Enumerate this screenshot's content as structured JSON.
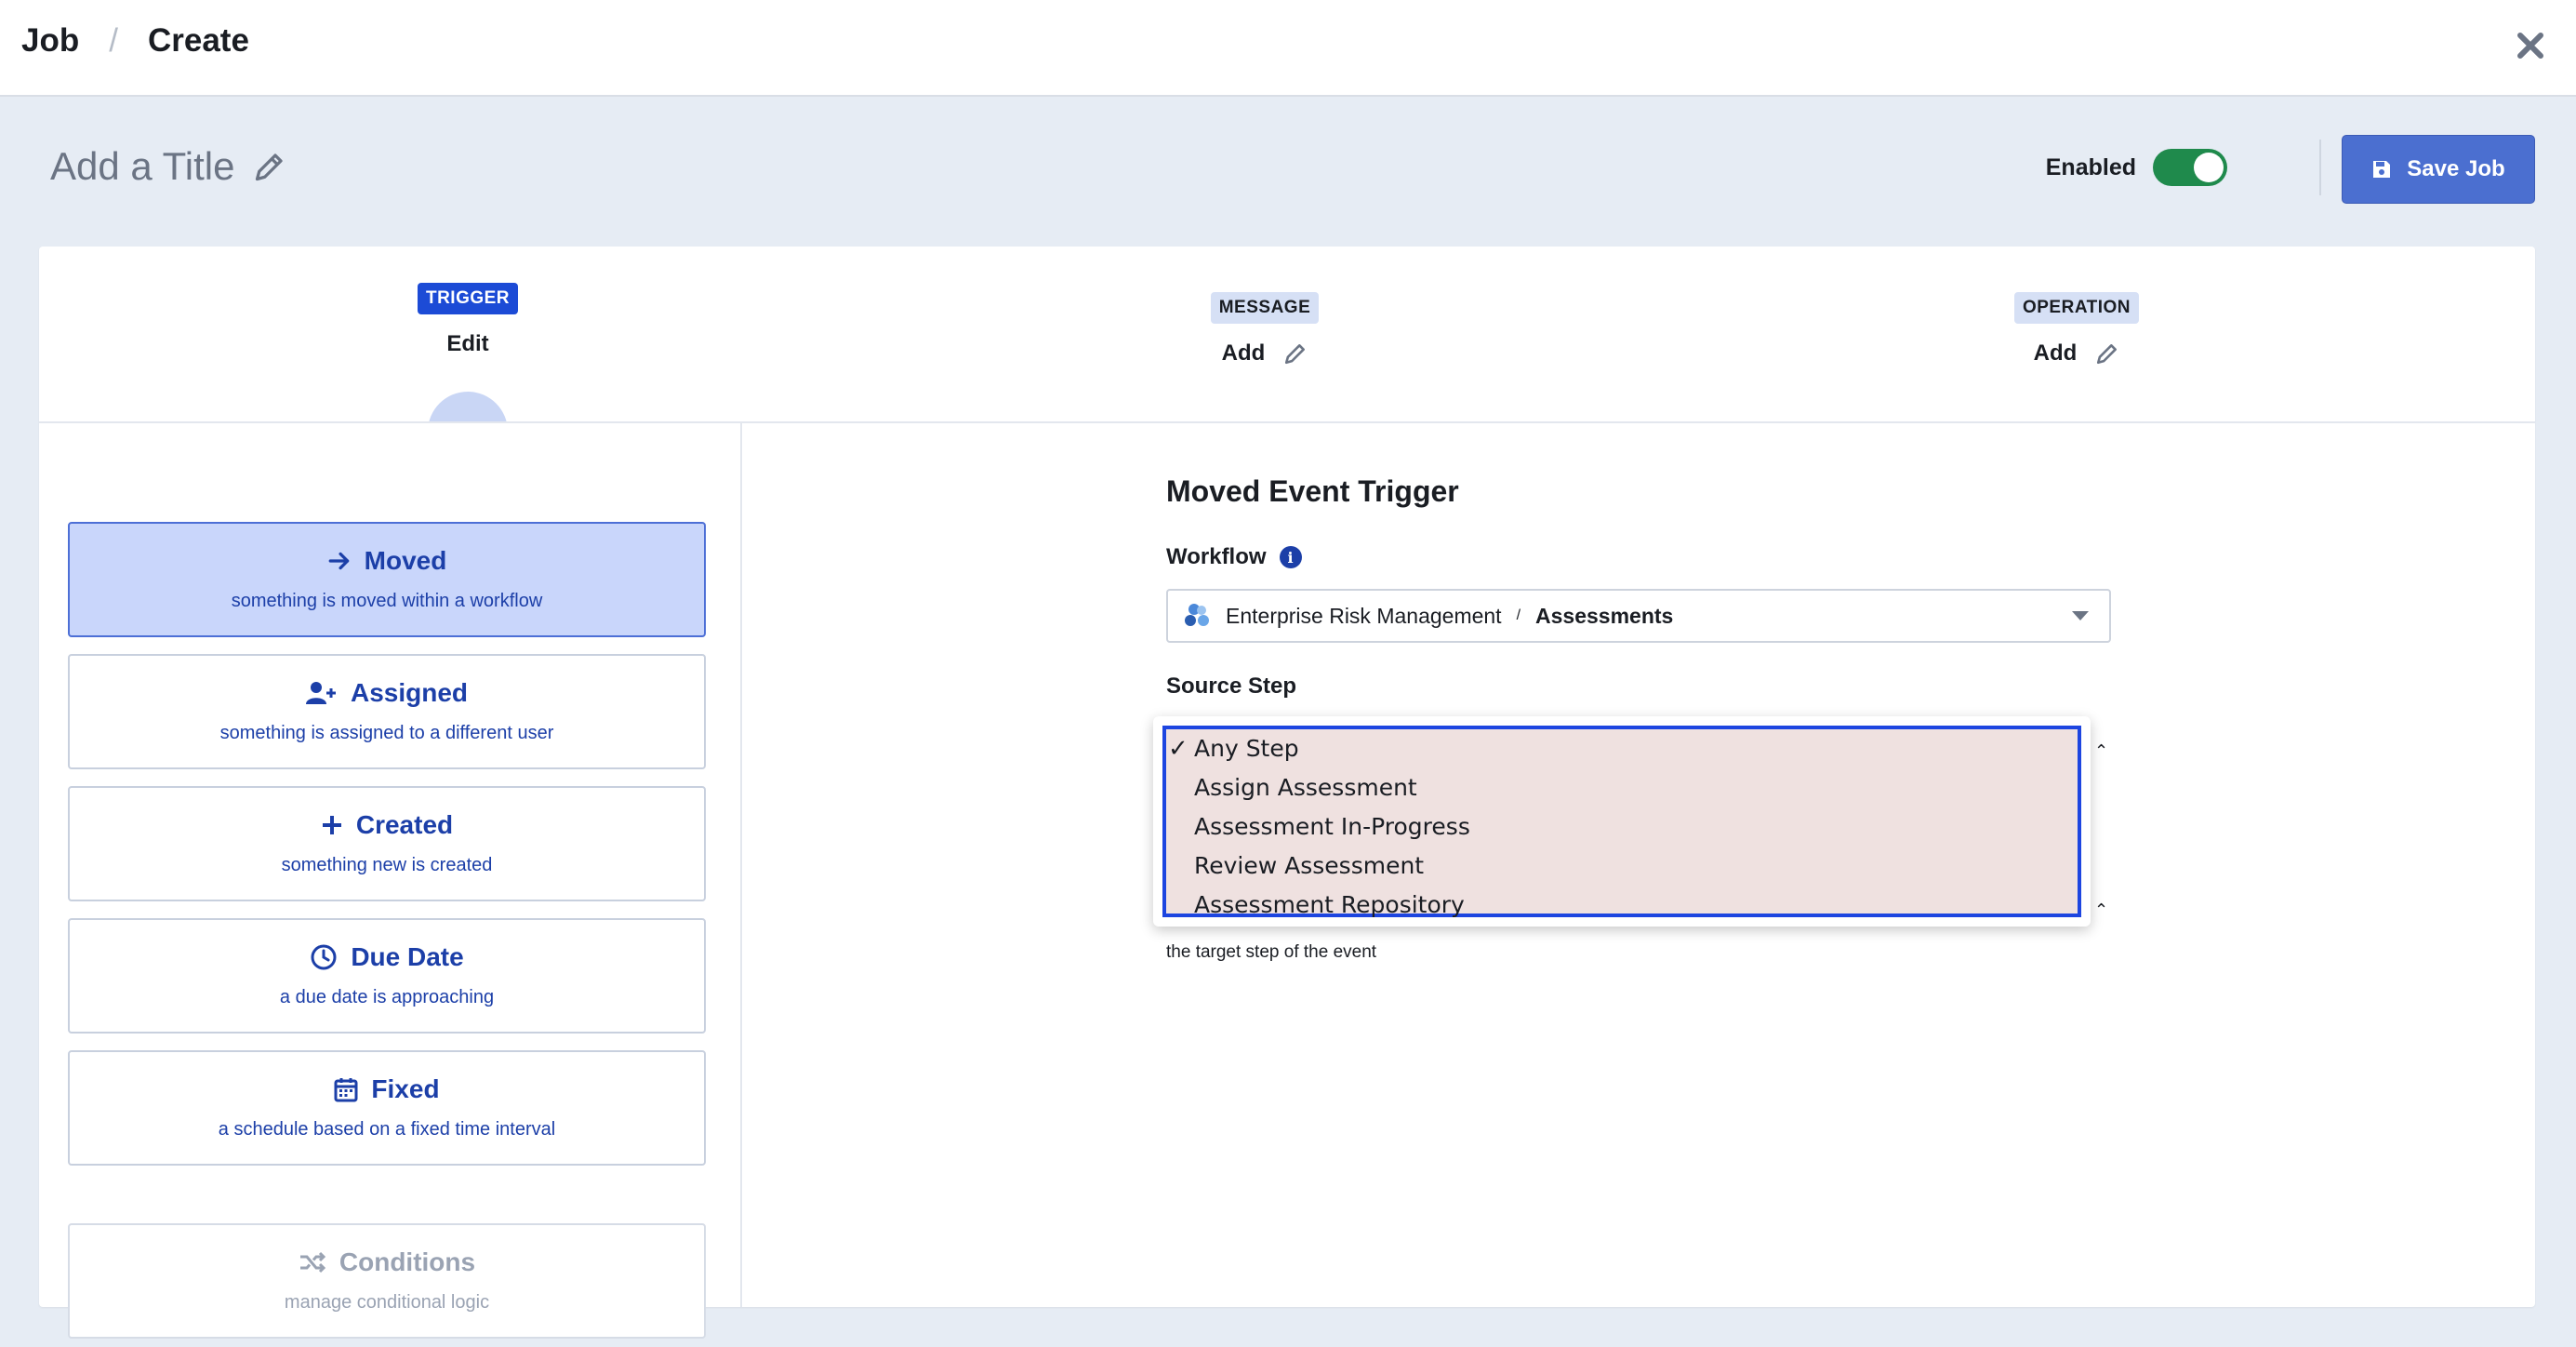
{
  "header": {
    "breadcrumb": [
      "Job",
      "Create"
    ],
    "separator": "/"
  },
  "title_row": {
    "title": "Add a Title",
    "enabled_label": "Enabled",
    "enabled": true,
    "save_label": "Save Job"
  },
  "stepper": {
    "stages": [
      {
        "tag": "TRIGGER",
        "sub": "Edit",
        "active": true
      },
      {
        "tag": "MESSAGE",
        "sub": "Add",
        "active": false
      },
      {
        "tag": "OPERATION",
        "sub": "Add",
        "active": false
      }
    ]
  },
  "triggers": [
    {
      "title": "Moved",
      "desc": "something is moved within a workflow",
      "icon": "arrow-right-icon",
      "active": true
    },
    {
      "title": "Assigned",
      "desc": "something is assigned to a different user",
      "icon": "user-plus-icon",
      "active": false
    },
    {
      "title": "Created",
      "desc": "something new is created",
      "icon": "plus-icon",
      "active": false
    },
    {
      "title": "Due Date",
      "desc": "a due date is approaching",
      "icon": "clock-icon",
      "active": false
    },
    {
      "title": "Fixed",
      "desc": "a schedule based on a fixed time interval",
      "icon": "calendar-icon",
      "active": false
    }
  ],
  "conditions": {
    "title": "Conditions",
    "desc": "manage conditional logic",
    "icon": "shuffle-icon"
  },
  "form": {
    "title": "Moved Event Trigger",
    "workflow_label": "Workflow",
    "workflow_app": "Enterprise Risk Management",
    "workflow_sep": "/",
    "workflow_name": "Assessments",
    "source_label": "Source Step",
    "target_hint": "the target step of the event"
  },
  "source_dropdown": {
    "selected_mark": "✓",
    "options": [
      "Any Step",
      "Assign Assessment",
      "Assessment In-Progress",
      "Review Assessment",
      "Assessment Repository"
    ],
    "selected": "Any Step"
  },
  "colors": {
    "accent": "#1c4bd6",
    "save_button": "#4b6fd0",
    "toggle_on": "#1f8a4c",
    "active_trigger_bg": "#c9d6fb",
    "focus_outline": "#1d45e0"
  }
}
